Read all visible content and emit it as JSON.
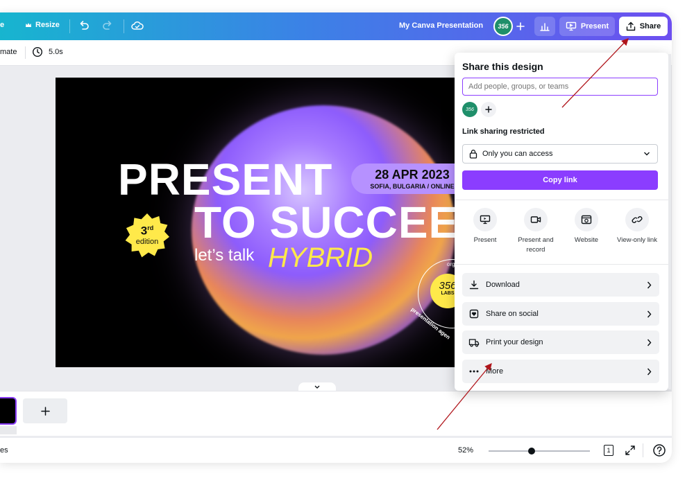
{
  "topbar": {
    "left_partial": "e",
    "resize_label": "Resize",
    "title": "My Canva Presentation",
    "avatar_text": "356",
    "present_label": "Present",
    "share_label": "Share"
  },
  "subbar": {
    "animate_partial": "mate",
    "duration": "5.0s"
  },
  "slide": {
    "line1": "PRESENT",
    "line2": "TO SUCCEE",
    "lets_talk": "let’s talk",
    "hybrid": "HYBRID",
    "date": "28 APR 2023",
    "location": "SOFIA, BULGARIA / ONLINE",
    "edition_num": "3",
    "edition_sup": "rd",
    "edition_word": "edition",
    "labs_num": "356",
    "labs_word": "LABS",
    "ring_top": "org",
    "ring_bottom": "presentation agen"
  },
  "share_panel": {
    "title": "Share this design",
    "input_placeholder": "Add people, groups, or teams",
    "avatar_text": "356",
    "link_label": "Link sharing restricted",
    "access_value": "Only you can access",
    "copy_link": "Copy link",
    "options": [
      {
        "icon": "present-icon",
        "label": "Present"
      },
      {
        "icon": "record-icon",
        "label": "Present and record"
      },
      {
        "icon": "website-icon",
        "label": "Website"
      },
      {
        "icon": "view-link-icon",
        "label": "View-only link"
      }
    ],
    "rows": [
      {
        "icon": "download-icon",
        "label": "Download"
      },
      {
        "icon": "social-icon",
        "label": "Share on social"
      },
      {
        "icon": "print-icon",
        "label": "Print your design"
      },
      {
        "icon": "more-icon",
        "label": "More"
      }
    ]
  },
  "footer": {
    "left_partial": "es",
    "zoom": "52%",
    "zoom_value_pct": 52,
    "page_num": "1"
  },
  "colors": {
    "accent": "#8b3dff",
    "topbar_start": "#17b5cf",
    "topbar_end": "#6d4ff0",
    "annotation_arrow": "#b0151b"
  }
}
